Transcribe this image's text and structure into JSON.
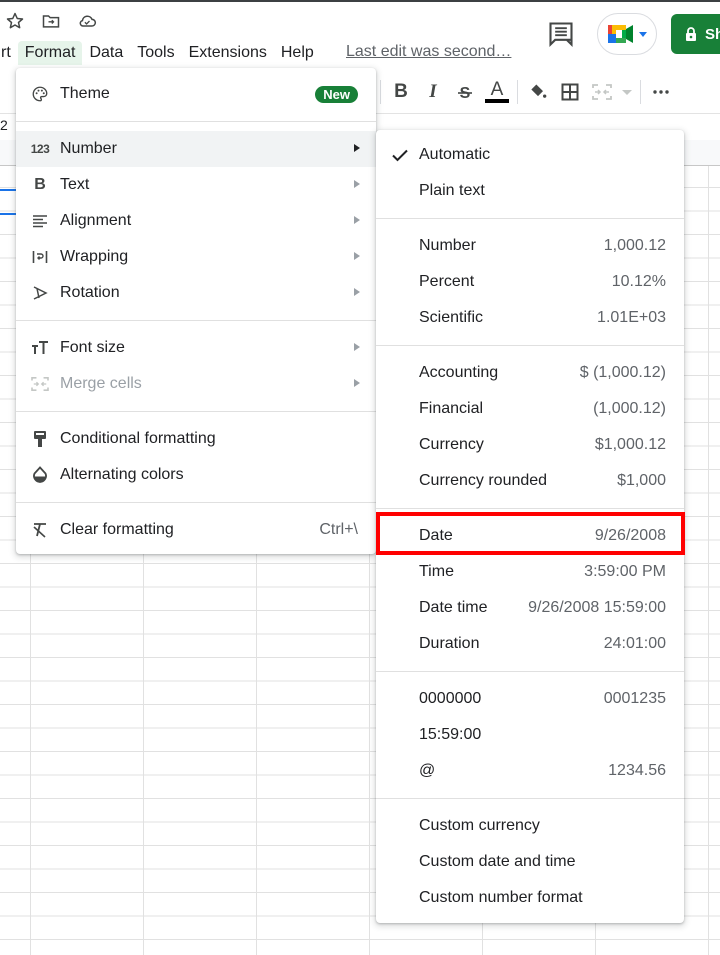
{
  "header": {
    "title_icons": [
      "star-icon",
      "move-to-folder-icon",
      "cloud-saved-icon"
    ],
    "menus": [
      {
        "label": "rt",
        "active": false
      },
      {
        "label": "Format",
        "active": true
      },
      {
        "label": "Data",
        "active": false
      },
      {
        "label": "Tools",
        "active": false
      },
      {
        "label": "Extensions",
        "active": false
      },
      {
        "label": "Help",
        "active": false
      }
    ],
    "last_edit": "Last edit was second…",
    "share_label": "Sh"
  },
  "formula_bar": {
    "cell_fragment": "2"
  },
  "toolbar": {
    "items": [
      "bold-icon",
      "italic-icon",
      "strikethrough-icon",
      "text-color-icon",
      "fill-color-icon",
      "borders-icon",
      "merge-cells-icon",
      "more-icon"
    ],
    "bold": "B",
    "italic": "I",
    "text_color_letter": "A",
    "text_color": "#000000"
  },
  "format_menu": {
    "theme": {
      "label": "Theme",
      "badge": "New"
    },
    "items_group1": [
      {
        "label": "Number",
        "icon": "123",
        "highlighted": true,
        "submenu": true,
        "disabled": false
      },
      {
        "label": "Text",
        "icon": "B",
        "highlighted": false,
        "submenu": true,
        "disabled": false
      },
      {
        "label": "Alignment",
        "icon": "align",
        "highlighted": false,
        "submenu": true,
        "disabled": false
      },
      {
        "label": "Wrapping",
        "icon": "wrap",
        "highlighted": false,
        "submenu": true,
        "disabled": false
      },
      {
        "label": "Rotation",
        "icon": "rotate",
        "highlighted": false,
        "submenu": true,
        "disabled": false
      }
    ],
    "items_group2": [
      {
        "label": "Font size",
        "submenu": true,
        "disabled": false
      },
      {
        "label": "Merge cells",
        "submenu": true,
        "disabled": true
      }
    ],
    "items_group3": [
      {
        "label": "Conditional formatting"
      },
      {
        "label": "Alternating colors"
      }
    ],
    "clear": {
      "label": "Clear formatting",
      "shortcut": "Ctrl+\\"
    }
  },
  "number_menu": {
    "groups": [
      [
        {
          "label": "Automatic",
          "value": "",
          "checked": true
        },
        {
          "label": "Plain text",
          "value": "",
          "checked": false
        }
      ],
      [
        {
          "label": "Number",
          "value": "1,000.12"
        },
        {
          "label": "Percent",
          "value": "10.12%"
        },
        {
          "label": "Scientific",
          "value": "1.01E+03"
        }
      ],
      [
        {
          "label": "Accounting",
          "value": "$ (1,000.12)"
        },
        {
          "label": "Financial",
          "value": "(1,000.12)"
        },
        {
          "label": "Currency",
          "value": "$1,000.12"
        },
        {
          "label": "Currency rounded",
          "value": "$1,000"
        }
      ],
      [
        {
          "label": "Date",
          "value": "9/26/2008",
          "annotated": true
        },
        {
          "label": "Time",
          "value": "3:59:00 PM"
        },
        {
          "label": "Date time",
          "value": "9/26/2008 15:59:00"
        },
        {
          "label": "Duration",
          "value": "24:01:00"
        }
      ],
      [
        {
          "label": "0000000",
          "value": "0001235"
        },
        {
          "label": "15:59:00",
          "value": ""
        },
        {
          "label": "@",
          "value": "1234.56"
        }
      ],
      [
        {
          "label": "Custom currency",
          "value": ""
        },
        {
          "label": "Custom date and time",
          "value": ""
        },
        {
          "label": "Custom number format",
          "value": ""
        }
      ]
    ]
  },
  "colors": {
    "accent_green": "#188038",
    "annotation_red": "#ff0000",
    "selection_blue": "#1a73e8"
  }
}
